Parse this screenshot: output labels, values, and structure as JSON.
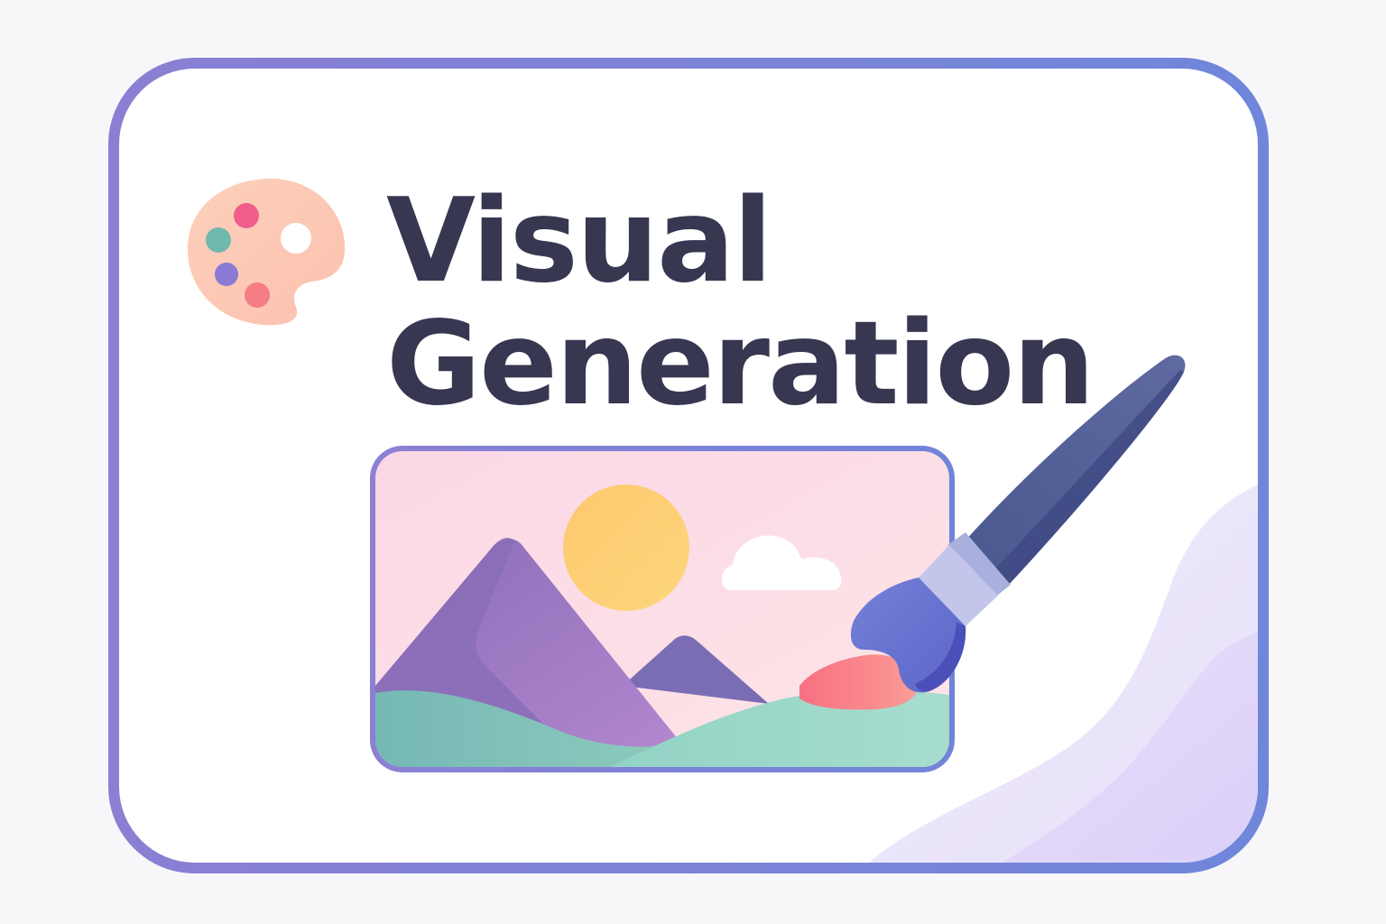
{
  "title": {
    "line1": "Visual",
    "line2": "Generation"
  },
  "icons": {
    "palette": "palette-icon",
    "landscape": "landscape-image-icon",
    "brush": "paint-brush-icon"
  },
  "colors": {
    "title_text": "#373752",
    "card_border_start": "#8a7fd3",
    "card_border_end": "#6f86da",
    "palette_base": "#fcc8b2",
    "palette_dot_pink": "#f05d8a",
    "palette_dot_teal": "#6fb8ad",
    "palette_dot_purple": "#8a7ad6",
    "palette_dot_coral": "#f47d86",
    "sun": "#fdcd72",
    "mountain": "#9c7cc6",
    "hills": "#8ccfc0",
    "brush_handle": "#4f5b92",
    "brush_ferrule": "#c1c4e8",
    "brush_bristles": "#6f7bd4",
    "paint_stroke": "#f98b91",
    "wave": "#e4dcf9"
  }
}
